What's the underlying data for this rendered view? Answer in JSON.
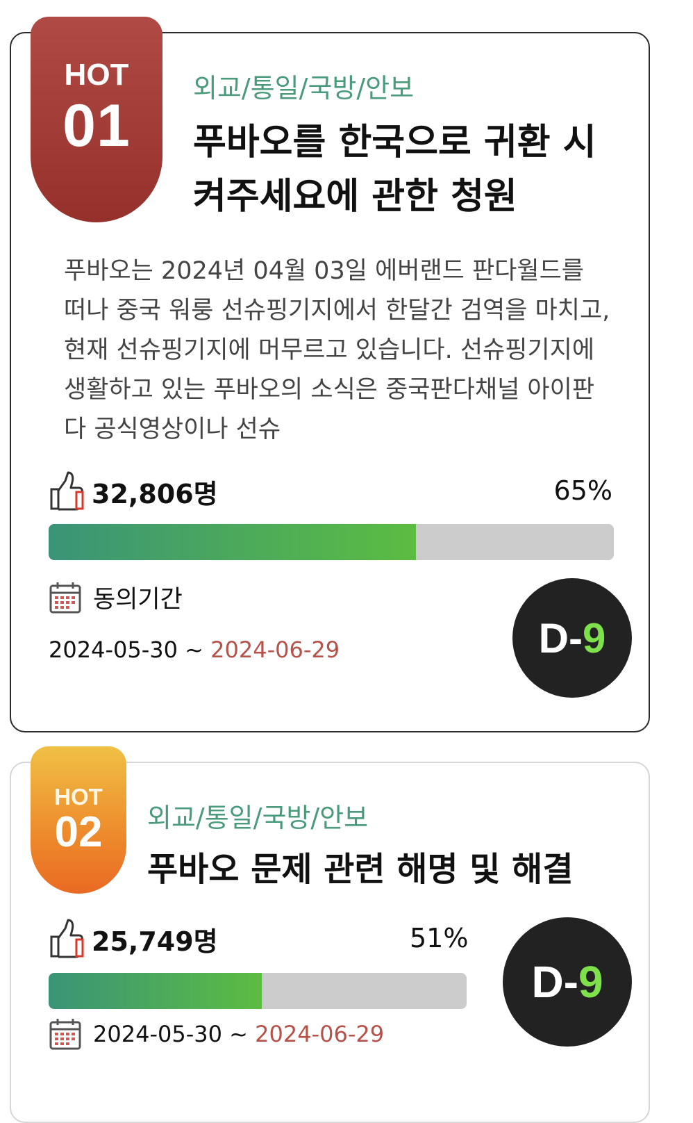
{
  "petitions": [
    {
      "rank_label": "HOT",
      "rank_number": "01",
      "category": "외교/통일/국방/안보",
      "title": "푸바오를 한국으로 귀환 시켜주세요에 관한 청원",
      "description": "푸바오는 2024년 04월 03일 에버랜드 판다월드를 떠나 중국 워룽 선슈핑기지에서 한달간 검역을 마치고, 현재 선슈핑기지에 머무르고 있습니다. 선슈핑기지에 생활하고 있는 푸바오의 소식은 중국판다채널 아이판다 공식영상이나 선슈",
      "supporters": "32,806명",
      "percent": "65%",
      "progress": 0.65,
      "period_label": "동의기간",
      "start_date": "2024-05-30",
      "separator": " ~ ",
      "end_date": "2024-06-29",
      "dday_prefix": "D-",
      "dday_number": "9"
    },
    {
      "rank_label": "HOT",
      "rank_number": "02",
      "category": "외교/통일/국방/안보",
      "title": "푸바오 문제 관련 해명 및 해결",
      "supporters": "25,749명",
      "percent": "51%",
      "progress": 0.51,
      "start_date": "2024-05-30",
      "separator": " ~ ",
      "end_date": "2024-06-29",
      "dday_prefix": "D-",
      "dday_number": "9"
    }
  ],
  "icons": {
    "like": "thumbs-up-icon",
    "calendar": "calendar-icon"
  },
  "colors": {
    "category": "#4a9a7c",
    "hot1": "#a03a35",
    "hot2": "#ed8a2c",
    "end_date": "#b5524a",
    "dday_number": "#7ee04a"
  }
}
